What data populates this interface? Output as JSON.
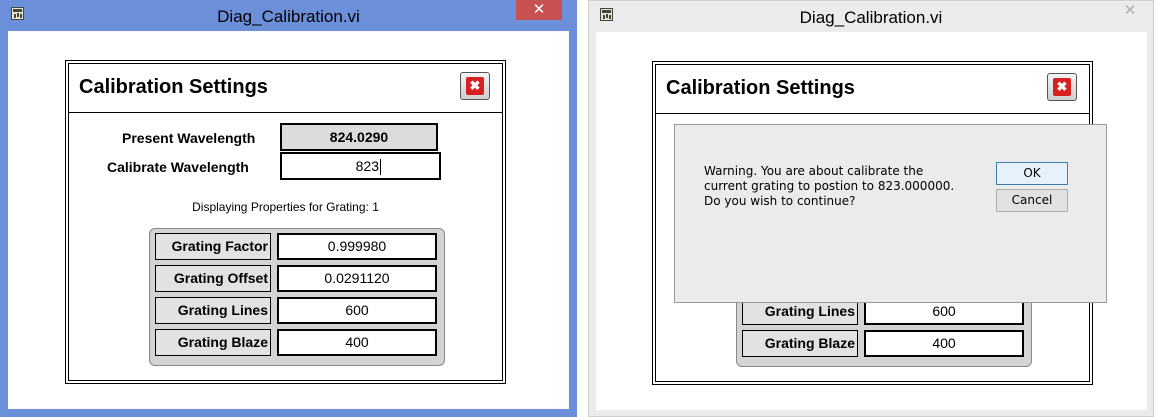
{
  "left_window": {
    "title": "Diag_Calibration.vi",
    "close_glyph": "✕",
    "panel": {
      "title": "Calibration Settings",
      "close_glyph": "✖",
      "present_wavelength_label": "Present Wavelength",
      "present_wavelength_value": "824.0290",
      "calibrate_wavelength_label": "Calibrate Wavelength",
      "calibrate_wavelength_value": "823",
      "status_text": "Displaying Properties for Grating: 1",
      "grating": [
        {
          "label": "Grating Factor",
          "value": "0.999980"
        },
        {
          "label": "Grating Offset",
          "value": "0.0291120"
        },
        {
          "label": "Grating Lines",
          "value": "600"
        },
        {
          "label": "Grating Blaze",
          "value": "400"
        }
      ]
    }
  },
  "right_window": {
    "title": "Diag_Calibration.vi",
    "close_glyph": "✕",
    "panel": {
      "title": "Calibration Settings",
      "close_glyph": "✖",
      "grating": [
        {
          "label": "Grating Lines",
          "value": "600"
        },
        {
          "label": "Grating Blaze",
          "value": "400"
        }
      ]
    },
    "dialog": {
      "message": "Warning. You are about calibrate the\ncurrent grating to postion to 823.000000.\nDo you wish to continue?",
      "ok_label": "OK",
      "cancel_label": "Cancel"
    }
  },
  "icons": {
    "app_icon": "labview-vi-icon",
    "window_close": "close-icon",
    "panel_close": "red-x-close-icon"
  },
  "colors": {
    "left_frame": "#6b8fd9",
    "right_frame": "#ebebeb",
    "close_red": "#c75050",
    "panel_close_red": "#d92020"
  }
}
